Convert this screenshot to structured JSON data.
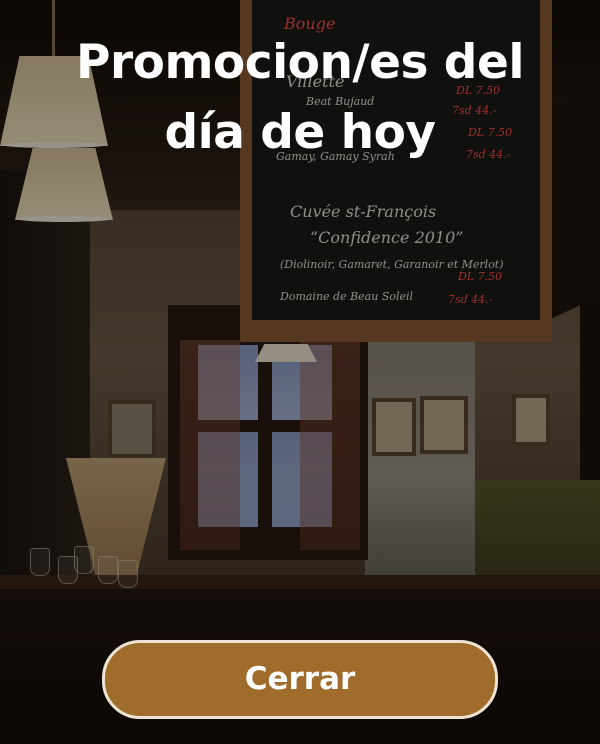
{
  "modal": {
    "title_line1": "Promocion/es del",
    "title_line2": "día de hoy",
    "close_label": "Cerrar"
  },
  "background": {
    "chalkboard_lines": [
      "Bouge",
      "Villette",
      "Beat Bujaud",
      "Gamay, Gamay Syrah",
      "Cuvée st-François",
      "“Confidence 2010”",
      "(Diolinoir, Gamaret, Garanoir et Merlot)",
      "Domaine de Beau Soleil",
      "DL 7.50",
      "7sd 44.-",
      "DL 7.50",
      "7sd 44.-",
      "DL 7.50",
      "7sd 44.-"
    ]
  },
  "colors": {
    "button_fill": "#a06c2c",
    "button_border": "#eee4d4",
    "title_text": "#ffffff"
  }
}
